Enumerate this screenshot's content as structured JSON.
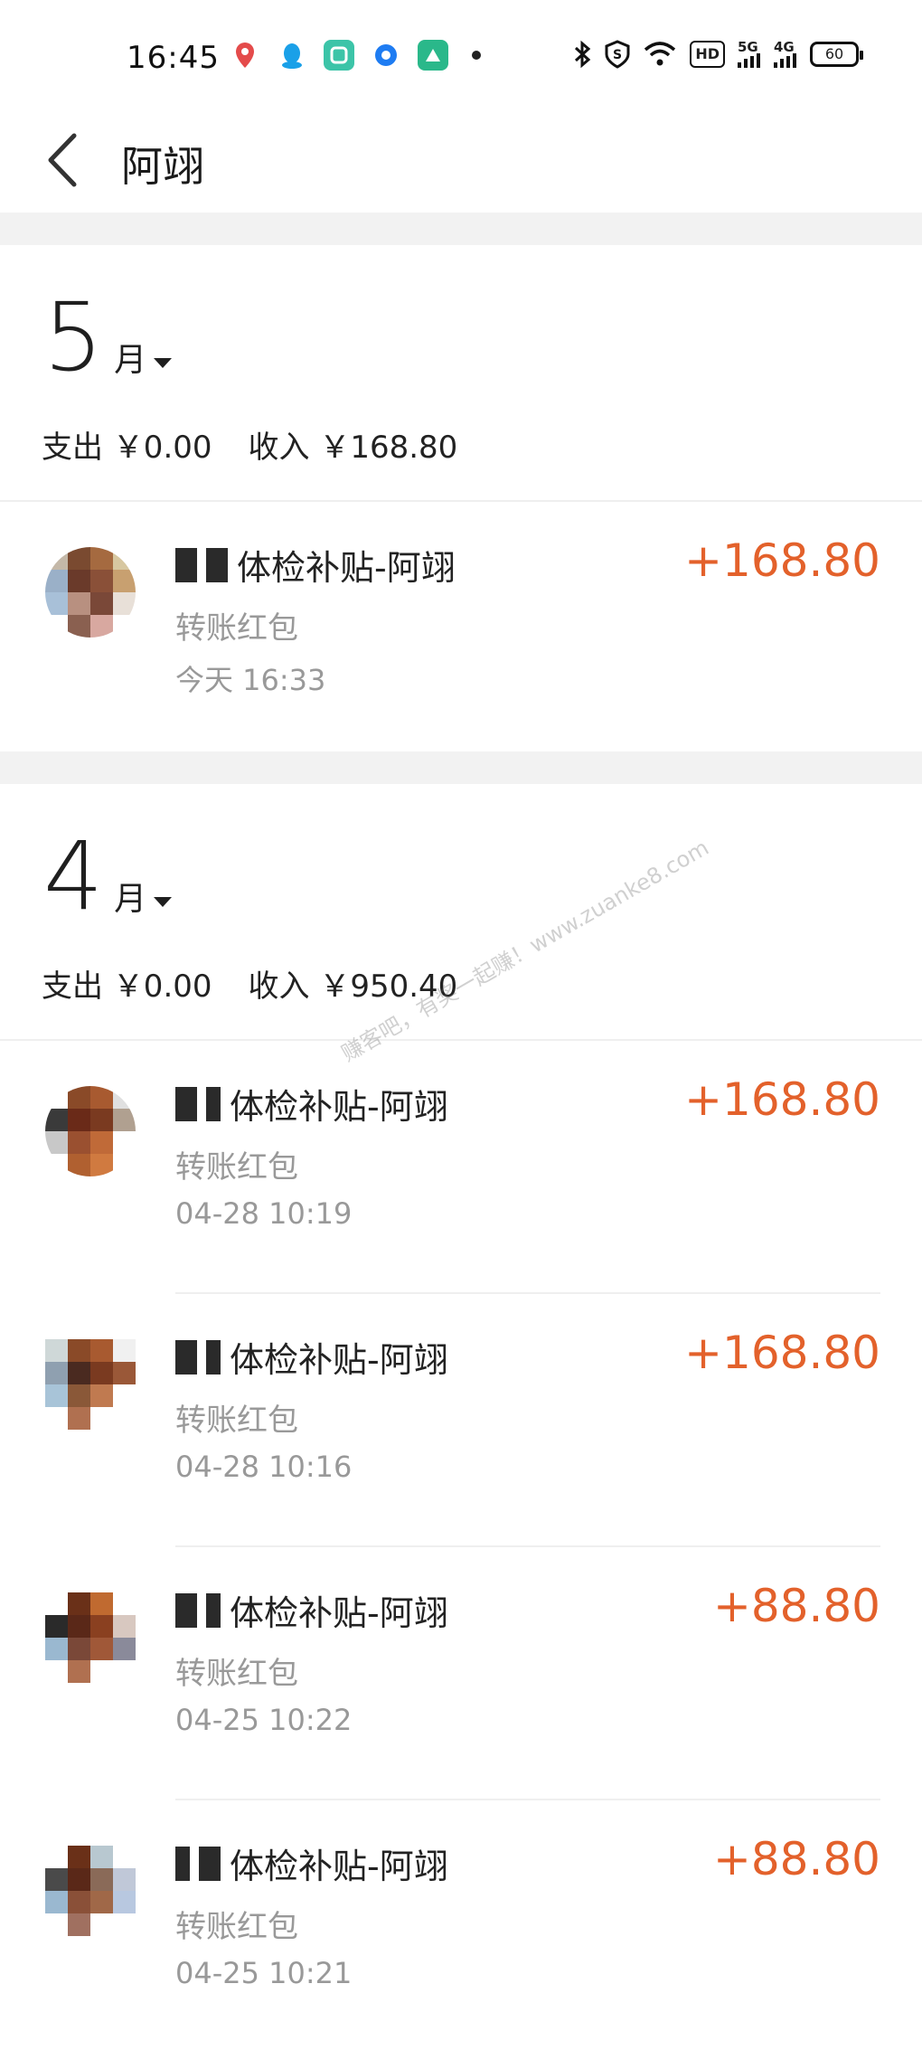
{
  "status_bar": {
    "time": "16:45",
    "battery": "60",
    "network_badge": "HD",
    "sig1": "5G",
    "sig2": "4G",
    "icons": [
      "map-pin-icon",
      "qq-icon",
      "notes-icon",
      "browser-icon",
      "app-icon",
      "dot-icon",
      "bluetooth-icon",
      "vpn-icon",
      "wifi-icon"
    ]
  },
  "header": {
    "title": "阿翊"
  },
  "colors": {
    "accent_amount": "#e3612b",
    "secondary_text": "#999999",
    "section_gap": "#f2f2f2"
  },
  "months": [
    {
      "number": "5",
      "unit": "月",
      "expense_label": "支出",
      "expense": "￥0.00",
      "income_label": "收入",
      "income": "￥168.80",
      "transactions": [
        {
          "title": "体检补贴-阿翊",
          "type": "转账红包",
          "time": "今天  16:33",
          "amount": "+168.80"
        }
      ]
    },
    {
      "number": "4",
      "unit": "月",
      "expense_label": "支出",
      "expense": "￥0.00",
      "income_label": "收入",
      "income": "￥950.40",
      "transactions": [
        {
          "title": "体检补贴-阿翊",
          "type": "转账红包",
          "time": "04-28  10:19",
          "amount": "+168.80"
        },
        {
          "title": "体检补贴-阿翊",
          "type": "转账红包",
          "time": "04-28  10:16",
          "amount": "+168.80"
        },
        {
          "title": "体检补贴-阿翊",
          "type": "转账红包",
          "time": "04-25  10:22",
          "amount": "+88.80"
        },
        {
          "title": "体检补贴-阿翊",
          "type": "转账红包",
          "time": "04-25  10:21",
          "amount": "+88.80"
        }
      ]
    }
  ],
  "watermark": "赚客吧，有奖一起赚！www.zuanke8.com"
}
